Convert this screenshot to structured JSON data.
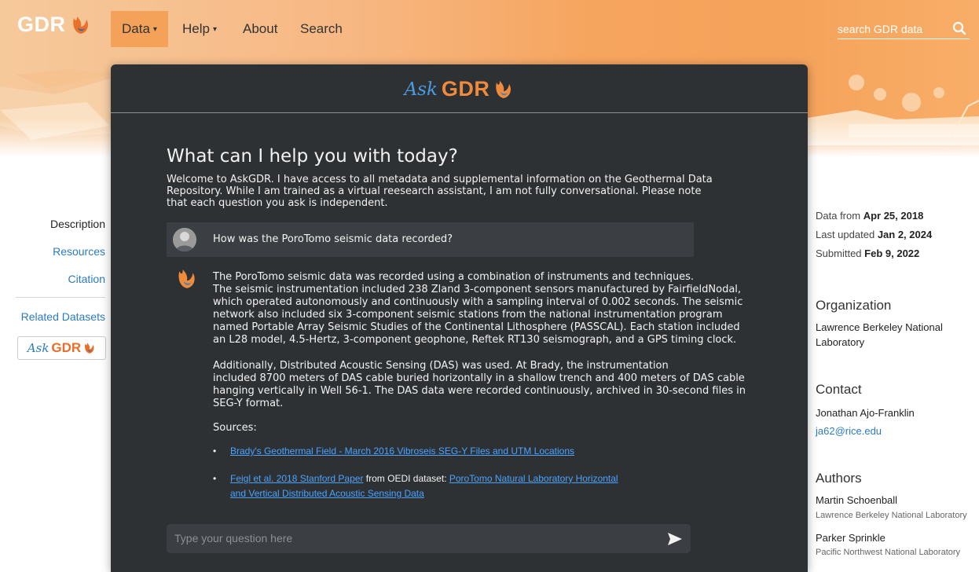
{
  "nav": {
    "logo_text": "GDR",
    "items": [
      {
        "label": "Data",
        "caret": "▾"
      },
      {
        "label": "Help",
        "caret": "▾"
      },
      {
        "label": "About",
        "caret": ""
      },
      {
        "label": "Search",
        "caret": ""
      }
    ],
    "search_placeholder": "search GDR data"
  },
  "leftnav": {
    "items": [
      "Description",
      "Resources",
      "Citation",
      "Related Datasets"
    ],
    "badge_ask": "Ask",
    "badge_gdr": "GDR"
  },
  "right": {
    "dates": [
      {
        "label": "Data from",
        "value": "Apr 25, 2018"
      },
      {
        "label": "Last updated",
        "value": "Jan 2, 2024"
      },
      {
        "label": "Submitted",
        "value": "Feb 9, 2022"
      }
    ],
    "organization": {
      "heading": "Organization",
      "name_line1": "Lawrence Berkeley National",
      "name_line2": "Laboratory"
    },
    "contact": {
      "heading": "Contact",
      "name": "Jonathan Ajo-Franklin",
      "email": "ja62@rice.edu"
    },
    "authors": {
      "heading": "Authors",
      "list": [
        {
          "name": "Martin Schoenball",
          "affiliation": "Lawrence Berkeley National Laboratory"
        },
        {
          "name": "Parker Sprinkle",
          "affiliation": "Pacific Northwest National Laboratory"
        }
      ]
    }
  },
  "modal": {
    "logo_ask": "Ask",
    "logo_gdr": "GDR",
    "headline": "What can I help you with today?",
    "welcome_lines": [
      "Welcome to AskGDR. I have access to all metadata and supplemental information on the Geothermal Data",
      "Repository. While I am trained as a virtual reesearch assistant, I am not fully conversational.  Please note",
      "that each question you ask is independent."
    ],
    "question": "How was the PoroTomo seismic data recorded?",
    "answer_p1": [
      "The PoroTomo seismic data was recorded using a combination of instruments and techniques.",
      "The seismic instrumentation included 238 Zland 3-component sensors manufactured by FairfieldNodal,",
      "which operated autonomously and continuously with a sampling interval of 0.002 seconds. The seismic",
      "network also included six 3-component seismic stations from the national instrumentation program",
      "named Portable Array Seismic Studies of the Continental Lithosphere (PASSCAL). Each station included",
      "an L28 model, 4.5-Hertz, 3-component geophone, Reftek RT130 seismograph, and a GPS timing clock."
    ],
    "answer_p2": [
      "Additionally, Distributed Acoustic Sensing (DAS) was used. At Brady, the instrumentation",
      "included 8700 meters of DAS cable buried horizontally in a shallow trench and 400 meters of DAS cable",
      "hanging vertically in Well 56-1. The DAS data were recorded continuously, archived in 30-second files in",
      "SEG-Y format."
    ],
    "sources_label": "Sources:",
    "sources": {
      "s1_link": "Brady's Geothermal Field - March 2016 Vibroseis SEG-Y Files and UTM Locations",
      "s2_link": "Feigl et al. 2018 Stanford Paper",
      "s2_mid": " from OEDI dataset: ",
      "s2_link2_line1": "PoroTomo Natural Laboratory Horizontal",
      "s2_link2_line2": "and Vertical Distributed Acoustic Sensing Data"
    },
    "input_placeholder": "Type your question here"
  },
  "colors": {
    "orange": "#f5a25a",
    "modal_bg": "#2e3134",
    "link_blue": "#2b7bbf",
    "modal_link": "#4aa3ff"
  }
}
